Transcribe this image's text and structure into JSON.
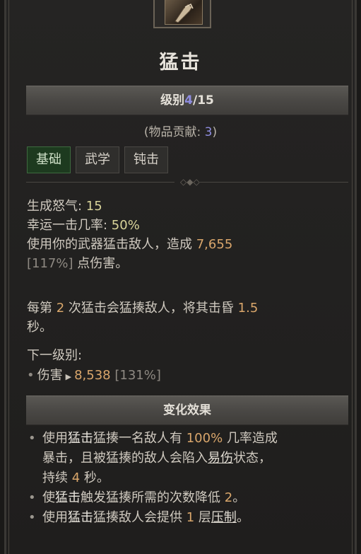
{
  "skill": {
    "title": "猛击",
    "icon": "mace-strike-icon"
  },
  "rank": {
    "label": "级别",
    "current": "4",
    "max": "/15"
  },
  "contrib": {
    "prefix": "(物品贡献: ",
    "value": "3",
    "suffix": ")"
  },
  "tags": [
    "基础",
    "武学",
    "钝击"
  ],
  "stats": {
    "fury_label": "生成怒气: ",
    "fury_value": "15",
    "lucky_label": "幸运一击几率: ",
    "lucky_value": "50%",
    "dmg_text": "使用你的武器猛击敌人，造成 ",
    "dmg_value": "7,655",
    "dmg_pct": "[117%]",
    "dmg_suffix": " 点伤害。"
  },
  "desc": {
    "p1": "每第 ",
    "n1": "2",
    "p2": " 次猛击会猛揍敌人，将其击昏 ",
    "n2": "1.5",
    "p3": "秒。"
  },
  "next": {
    "title": "下一级别:",
    "label": "伤害",
    "value": "8,538",
    "pct": "[131%]"
  },
  "mods": {
    "header": "变化效果",
    "items": [
      {
        "a": "使用",
        "b": "猛击",
        "c": "猛揍一名敌人有 ",
        "d": "100%",
        "e": " 几率造成",
        "f": "暴击，且被猛揍的敌人会陷入",
        "g": "易伤",
        "h": "状态，",
        "i": "持续 ",
        "j": "4",
        "k": " 秒。"
      },
      {
        "a": "使",
        "b": "猛击",
        "c": "触发猛揍所需的次数降低 ",
        "d": "2",
        "e": "。"
      },
      {
        "a": "使用",
        "b": "猛击",
        "c": "猛揍敌人会提供 ",
        "d": "1",
        "e": " 层",
        "f": "压制",
        "g": "。"
      }
    ]
  }
}
